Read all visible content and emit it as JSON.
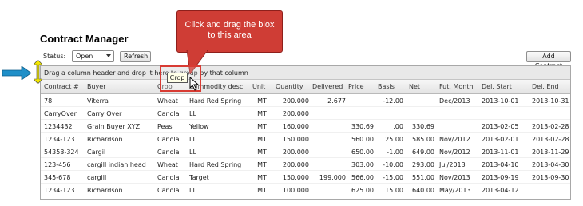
{
  "title": "Contract Manager",
  "toolbar": {
    "status_label": "Status:",
    "status_value": "Open",
    "refresh_label": "Refresh",
    "add_label": "Add Contract"
  },
  "grid": {
    "group_hint": "Drag a column header and drop it here to group by that column",
    "columns": [
      "Contract #",
      "Buyer",
      "Crop",
      "Commodity desc",
      "Unit",
      "Quantity",
      "Delivered",
      "Price",
      "Basis",
      "Net",
      "Fut. Month",
      "Del. Start",
      "Del. End"
    ],
    "rows": [
      [
        "78",
        "Viterra",
        "Wheat",
        "Hard Red Spring",
        "MT",
        "200.000",
        "2.677",
        "",
        "-12.00",
        "",
        "Dec/2013",
        "2013-10-01",
        "2013-10-31"
      ],
      [
        "CarryOver",
        "Carry Over",
        "Canola",
        "LL",
        "MT",
        "200.000",
        "",
        "",
        "",
        "",
        "",
        "",
        ""
      ],
      [
        "1234432",
        "Grain Buyer XYZ",
        "Peas",
        "Yellow",
        "MT",
        "160.000",
        "",
        "330.69",
        ".00",
        "330.69",
        "",
        "2013-02-05",
        "2013-02-28"
      ],
      [
        "1234-123",
        "Richardson",
        "Canola",
        "LL",
        "MT",
        "150.000",
        "",
        "560.00",
        "25.00",
        "585.00",
        "Nov/2012",
        "2013-02-01",
        "2013-02-28"
      ],
      [
        "54353-324",
        "Cargil",
        "Canola",
        "LL",
        "MT",
        "200.000",
        "",
        "650.00",
        "-1.00",
        "649.00",
        "Nov/2012",
        "2013-11-01",
        "2013-11-29"
      ],
      [
        "123-456",
        "cargill indian head",
        "Wheat",
        "Hard Red Spring",
        "MT",
        "200.000",
        "",
        "303.00",
        "-10.00",
        "293.00",
        "Jul/2013",
        "2013-04-10",
        "2013-04-30"
      ],
      [
        "345-678",
        "cargill",
        "Canola",
        "Target",
        "MT",
        "150.000",
        "199.000",
        "566.00",
        "-15.00",
        "551.00",
        "Nov/2013",
        "2013-09-19",
        "2013-09-30"
      ],
      [
        "1234-123",
        "Richardson",
        "Canola",
        "LL",
        "MT",
        "100.000",
        "",
        "625.00",
        "15.00",
        "640.00",
        "May/2013",
        "2013-04-12",
        ""
      ]
    ]
  },
  "callout": {
    "line1": "Click and drag the blox",
    "line2": "to this area"
  },
  "drag_label": "Crop",
  "colors": {
    "callout_red": "#cf3d35",
    "arrow_blue": "#1f8fc8",
    "marker_yellow": "#f2e600"
  }
}
